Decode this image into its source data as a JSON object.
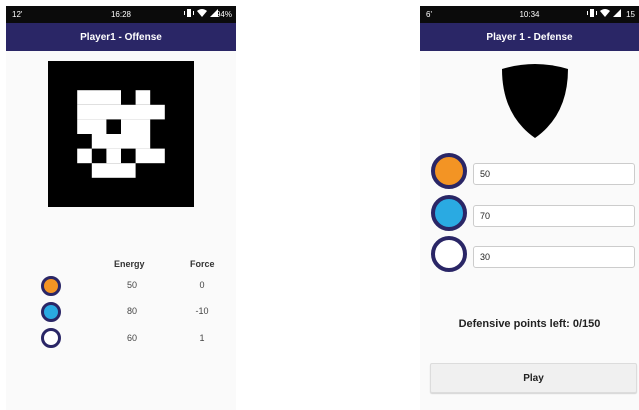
{
  "offense": {
    "status": {
      "left": "12'",
      "time": "16:28",
      "battery": "94%"
    },
    "title": "Player1 - Offense",
    "headers": {
      "energy": "Energy",
      "force": "Force"
    },
    "rows": [
      {
        "color": "#f39424",
        "energy": "50",
        "force": "0"
      },
      {
        "color": "#2aaae2",
        "energy": "80",
        "force": "-10"
      },
      {
        "color": "#ffffff",
        "energy": "60",
        "force": "1"
      }
    ]
  },
  "defense": {
    "status": {
      "left": "6'",
      "time": "10:34",
      "battery": "15"
    },
    "title": "Player 1 - Defense",
    "inputs": [
      {
        "color": "#f39424",
        "value": "50"
      },
      {
        "color": "#2aaae2",
        "value": "70"
      },
      {
        "color": "#ffffff",
        "value": "30"
      }
    ],
    "points_text": "Defensive points left: 0/150",
    "play_label": "Play"
  },
  "colors": {
    "appbar": "#2a2666",
    "ring": "#2a2666"
  }
}
